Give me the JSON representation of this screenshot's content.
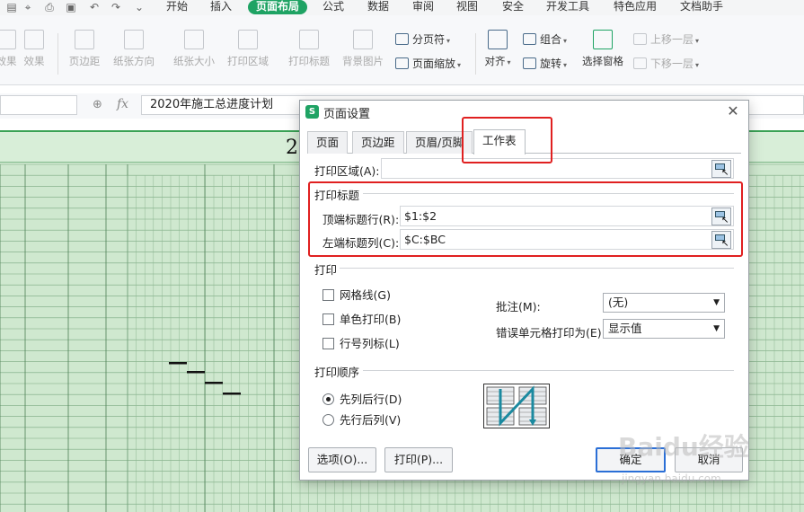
{
  "menubar": {
    "items": [
      "开始",
      "插入",
      "页面布局",
      "公式",
      "数据",
      "审阅",
      "视图",
      "安全",
      "开发工具",
      "特色应用",
      "文档助手"
    ],
    "active_index": 2,
    "quick_access_icons": [
      "layout-icon",
      "format-painter-icon",
      "print-icon",
      "undo-icon",
      "redo-icon",
      "dropdown-icon"
    ]
  },
  "ribbon": {
    "big_buttons": [
      "效果",
      "页边距",
      "纸张方向",
      "纸张大小",
      "打印区域",
      "打印标题",
      "背景图片"
    ],
    "page_break_label": "分页符",
    "page_zoom_label": "页面缩放",
    "align_label": "对齐",
    "group_label": "组合",
    "rotate_label": "旋转",
    "selection_pane_label": "选择窗格",
    "bring_forward_label": "上移一层",
    "send_backward_label": "下移一层"
  },
  "formulabar": {
    "fx_label": "fx",
    "value": "2020年施工总进度计划"
  },
  "sheet": {
    "title_fragment": "2",
    "accent_color": "#3aa255"
  },
  "dialog": {
    "title": "页面设置",
    "logo_text": "S",
    "close_symbol": "✕",
    "tabs": [
      "页面",
      "页边距",
      "页眉/页脚",
      "工作表"
    ],
    "active_tab_index": 3,
    "print_area_label": "打印区域(A):",
    "print_area_value": "",
    "print_titles_section": "打印标题",
    "top_rows_label": "顶端标题行(R):",
    "top_rows_value": "$1:$2",
    "left_cols_label": "左端标题列(C):",
    "left_cols_value": "$C:$BC",
    "print_section": "打印",
    "gridlines_label": "网格线(G)",
    "mono_label": "单色打印(B)",
    "rowcol_label": "行号列标(L)",
    "comments_label": "批注(M):",
    "comments_value": "(无)",
    "errors_label": "错误单元格打印为(E):",
    "errors_value": "显示值",
    "order_section": "打印顺序",
    "order_down_over": "先列后行(D)",
    "order_over_down": "先行后列(V)",
    "order_selected": "先列后行(D)",
    "options_button": "选项(O)...",
    "print_button": "打印(P)...",
    "ok_button": "确定",
    "cancel_button": "取消"
  },
  "watermark": {
    "brand": "Baidu经验",
    "url": "jingyan.baidu.com"
  },
  "colors": {
    "accent": "#1fa364",
    "annotation": "#e02020",
    "sheet_fill": "#cfe8cf"
  }
}
